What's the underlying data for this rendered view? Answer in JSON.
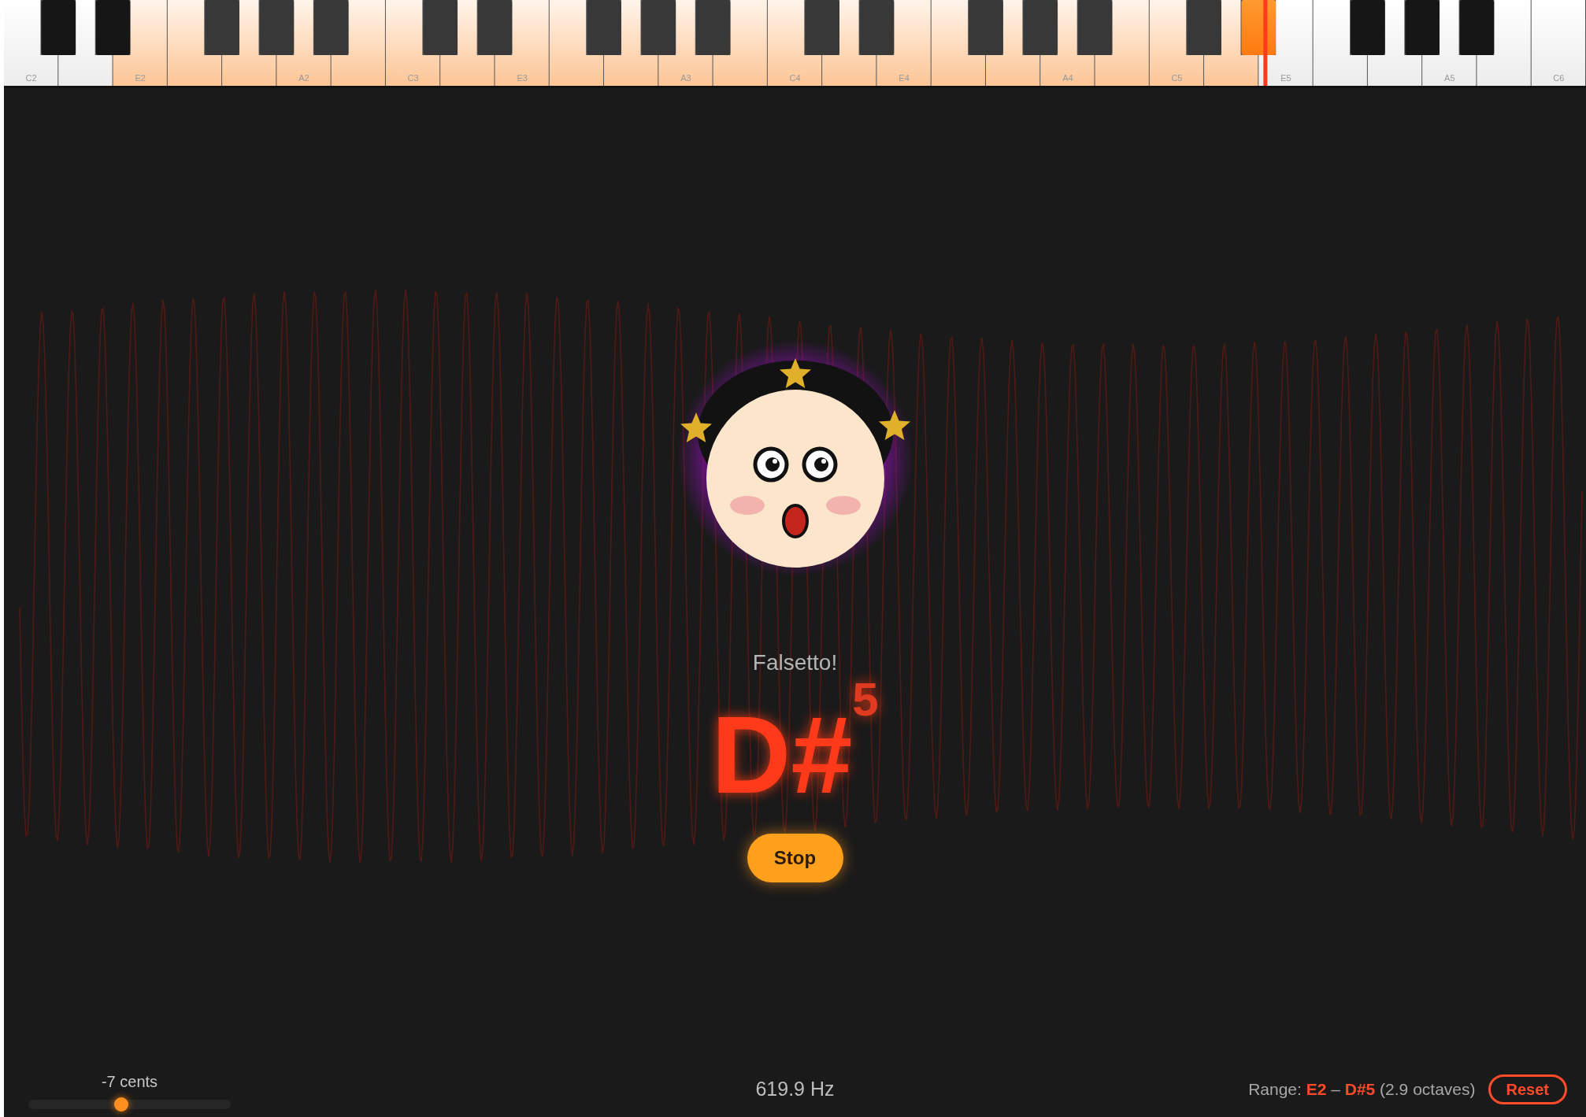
{
  "keyboard": {
    "keys": [
      {
        "kind": "white",
        "label": "C2",
        "in_range": false,
        "selected": false
      },
      {
        "kind": "black",
        "in_range": false,
        "selected": false
      },
      {
        "kind": "white",
        "in_range": false,
        "selected": false
      },
      {
        "kind": "black",
        "in_range": false,
        "selected": false
      },
      {
        "kind": "white",
        "label": "E2",
        "in_range": true,
        "selected": false
      },
      {
        "kind": "white",
        "in_range": true,
        "selected": false
      },
      {
        "kind": "black",
        "in_range": true,
        "selected": false
      },
      {
        "kind": "white",
        "in_range": true,
        "selected": false
      },
      {
        "kind": "black",
        "in_range": true,
        "selected": false
      },
      {
        "kind": "white",
        "label": "A2",
        "in_range": true,
        "selected": false
      },
      {
        "kind": "black",
        "in_range": true,
        "selected": false
      },
      {
        "kind": "white",
        "in_range": true,
        "selected": false
      },
      {
        "kind": "white",
        "label": "C3",
        "in_range": true,
        "selected": false
      },
      {
        "kind": "black",
        "in_range": true,
        "selected": false
      },
      {
        "kind": "white",
        "in_range": true,
        "selected": false
      },
      {
        "kind": "black",
        "in_range": true,
        "selected": false
      },
      {
        "kind": "white",
        "label": "E3",
        "in_range": true,
        "selected": false
      },
      {
        "kind": "white",
        "in_range": true,
        "selected": false
      },
      {
        "kind": "black",
        "in_range": true,
        "selected": false
      },
      {
        "kind": "white",
        "in_range": true,
        "selected": false
      },
      {
        "kind": "black",
        "in_range": true,
        "selected": false
      },
      {
        "kind": "white",
        "label": "A3",
        "in_range": true,
        "selected": false
      },
      {
        "kind": "black",
        "in_range": true,
        "selected": false
      },
      {
        "kind": "white",
        "in_range": true,
        "selected": false
      },
      {
        "kind": "white",
        "label": "C4",
        "in_range": true,
        "selected": false
      },
      {
        "kind": "black",
        "in_range": true,
        "selected": false
      },
      {
        "kind": "white",
        "in_range": true,
        "selected": false
      },
      {
        "kind": "black",
        "in_range": true,
        "selected": false
      },
      {
        "kind": "white",
        "label": "E4",
        "in_range": true,
        "selected": false
      },
      {
        "kind": "white",
        "in_range": true,
        "selected": false
      },
      {
        "kind": "black",
        "in_range": true,
        "selected": false
      },
      {
        "kind": "white",
        "in_range": true,
        "selected": false
      },
      {
        "kind": "black",
        "in_range": true,
        "selected": false
      },
      {
        "kind": "white",
        "label": "A4",
        "in_range": true,
        "selected": false
      },
      {
        "kind": "black",
        "in_range": true,
        "selected": false
      },
      {
        "kind": "white",
        "in_range": true,
        "selected": false
      },
      {
        "kind": "white",
        "label": "C5",
        "in_range": true,
        "selected": false
      },
      {
        "kind": "black",
        "in_range": true,
        "selected": false
      },
      {
        "kind": "white",
        "in_range": true,
        "selected": false
      },
      {
        "kind": "black",
        "in_range": true,
        "selected": true
      },
      {
        "kind": "white",
        "label": "E5",
        "in_range": false,
        "selected": false
      },
      {
        "kind": "white",
        "in_range": false,
        "selected": false
      },
      {
        "kind": "black",
        "in_range": false,
        "selected": false
      },
      {
        "kind": "white",
        "in_range": false,
        "selected": false
      },
      {
        "kind": "black",
        "in_range": false,
        "selected": false
      },
      {
        "kind": "white",
        "label": "A5",
        "in_range": false,
        "selected": false
      },
      {
        "kind": "black",
        "in_range": false,
        "selected": false
      },
      {
        "kind": "white",
        "in_range": false,
        "selected": false
      },
      {
        "kind": "white",
        "label": "C6",
        "in_range": false,
        "selected": false
      }
    ]
  },
  "mood": "Falsetto!",
  "note": "D#$^{5}$",
  "stop_button": "Stop",
  "tuning": {
    "reading": "-7 cents",
    "level": 0.46
  },
  "frequency": "619.9 Hz",
  "range": {
    "label": "Range:",
    "low": "E2",
    "separator": "–",
    "high": "D#5",
    "span": "(2.9 octaves)"
  },
  "reset_button": "Reset"
}
